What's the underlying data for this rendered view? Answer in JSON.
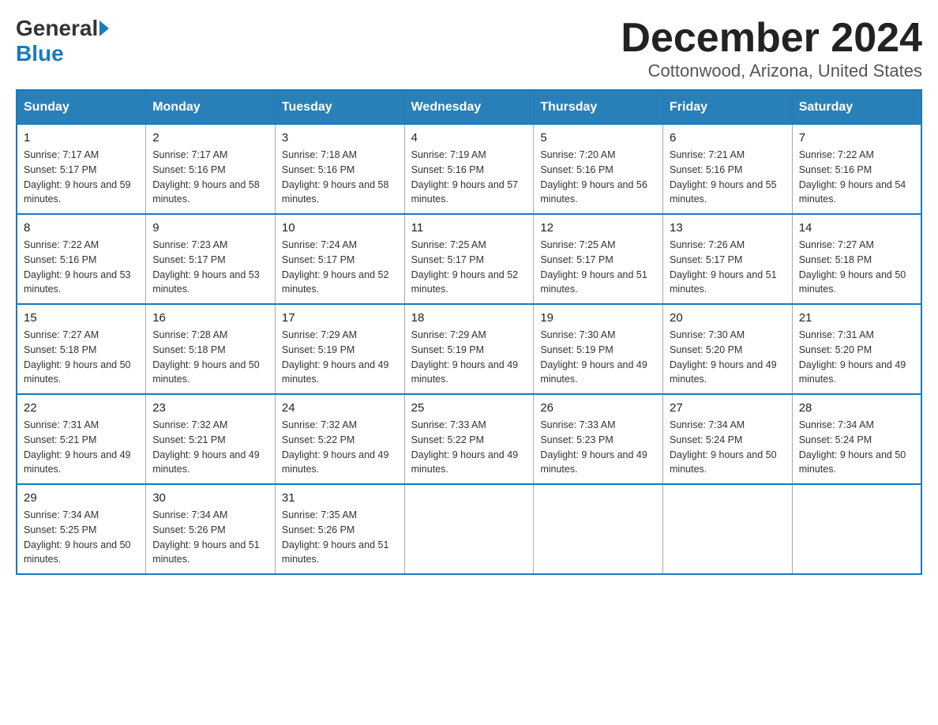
{
  "logo": {
    "general": "General",
    "blue": "Blue"
  },
  "title": "December 2024",
  "subtitle": "Cottonwood, Arizona, United States",
  "days_of_week": [
    "Sunday",
    "Monday",
    "Tuesday",
    "Wednesday",
    "Thursday",
    "Friday",
    "Saturday"
  ],
  "weeks": [
    [
      {
        "day": "1",
        "sunrise": "7:17 AM",
        "sunset": "5:17 PM",
        "daylight": "9 hours and 59 minutes."
      },
      {
        "day": "2",
        "sunrise": "7:17 AM",
        "sunset": "5:16 PM",
        "daylight": "9 hours and 58 minutes."
      },
      {
        "day": "3",
        "sunrise": "7:18 AM",
        "sunset": "5:16 PM",
        "daylight": "9 hours and 58 minutes."
      },
      {
        "day": "4",
        "sunrise": "7:19 AM",
        "sunset": "5:16 PM",
        "daylight": "9 hours and 57 minutes."
      },
      {
        "day": "5",
        "sunrise": "7:20 AM",
        "sunset": "5:16 PM",
        "daylight": "9 hours and 56 minutes."
      },
      {
        "day": "6",
        "sunrise": "7:21 AM",
        "sunset": "5:16 PM",
        "daylight": "9 hours and 55 minutes."
      },
      {
        "day": "7",
        "sunrise": "7:22 AM",
        "sunset": "5:16 PM",
        "daylight": "9 hours and 54 minutes."
      }
    ],
    [
      {
        "day": "8",
        "sunrise": "7:22 AM",
        "sunset": "5:16 PM",
        "daylight": "9 hours and 53 minutes."
      },
      {
        "day": "9",
        "sunrise": "7:23 AM",
        "sunset": "5:17 PM",
        "daylight": "9 hours and 53 minutes."
      },
      {
        "day": "10",
        "sunrise": "7:24 AM",
        "sunset": "5:17 PM",
        "daylight": "9 hours and 52 minutes."
      },
      {
        "day": "11",
        "sunrise": "7:25 AM",
        "sunset": "5:17 PM",
        "daylight": "9 hours and 52 minutes."
      },
      {
        "day": "12",
        "sunrise": "7:25 AM",
        "sunset": "5:17 PM",
        "daylight": "9 hours and 51 minutes."
      },
      {
        "day": "13",
        "sunrise": "7:26 AM",
        "sunset": "5:17 PM",
        "daylight": "9 hours and 51 minutes."
      },
      {
        "day": "14",
        "sunrise": "7:27 AM",
        "sunset": "5:18 PM",
        "daylight": "9 hours and 50 minutes."
      }
    ],
    [
      {
        "day": "15",
        "sunrise": "7:27 AM",
        "sunset": "5:18 PM",
        "daylight": "9 hours and 50 minutes."
      },
      {
        "day": "16",
        "sunrise": "7:28 AM",
        "sunset": "5:18 PM",
        "daylight": "9 hours and 50 minutes."
      },
      {
        "day": "17",
        "sunrise": "7:29 AM",
        "sunset": "5:19 PM",
        "daylight": "9 hours and 49 minutes."
      },
      {
        "day": "18",
        "sunrise": "7:29 AM",
        "sunset": "5:19 PM",
        "daylight": "9 hours and 49 minutes."
      },
      {
        "day": "19",
        "sunrise": "7:30 AM",
        "sunset": "5:19 PM",
        "daylight": "9 hours and 49 minutes."
      },
      {
        "day": "20",
        "sunrise": "7:30 AM",
        "sunset": "5:20 PM",
        "daylight": "9 hours and 49 minutes."
      },
      {
        "day": "21",
        "sunrise": "7:31 AM",
        "sunset": "5:20 PM",
        "daylight": "9 hours and 49 minutes."
      }
    ],
    [
      {
        "day": "22",
        "sunrise": "7:31 AM",
        "sunset": "5:21 PM",
        "daylight": "9 hours and 49 minutes."
      },
      {
        "day": "23",
        "sunrise": "7:32 AM",
        "sunset": "5:21 PM",
        "daylight": "9 hours and 49 minutes."
      },
      {
        "day": "24",
        "sunrise": "7:32 AM",
        "sunset": "5:22 PM",
        "daylight": "9 hours and 49 minutes."
      },
      {
        "day": "25",
        "sunrise": "7:33 AM",
        "sunset": "5:22 PM",
        "daylight": "9 hours and 49 minutes."
      },
      {
        "day": "26",
        "sunrise": "7:33 AM",
        "sunset": "5:23 PM",
        "daylight": "9 hours and 49 minutes."
      },
      {
        "day": "27",
        "sunrise": "7:34 AM",
        "sunset": "5:24 PM",
        "daylight": "9 hours and 50 minutes."
      },
      {
        "day": "28",
        "sunrise": "7:34 AM",
        "sunset": "5:24 PM",
        "daylight": "9 hours and 50 minutes."
      }
    ],
    [
      {
        "day": "29",
        "sunrise": "7:34 AM",
        "sunset": "5:25 PM",
        "daylight": "9 hours and 50 minutes."
      },
      {
        "day": "30",
        "sunrise": "7:34 AM",
        "sunset": "5:26 PM",
        "daylight": "9 hours and 51 minutes."
      },
      {
        "day": "31",
        "sunrise": "7:35 AM",
        "sunset": "5:26 PM",
        "daylight": "9 hours and 51 minutes."
      },
      null,
      null,
      null,
      null
    ]
  ]
}
